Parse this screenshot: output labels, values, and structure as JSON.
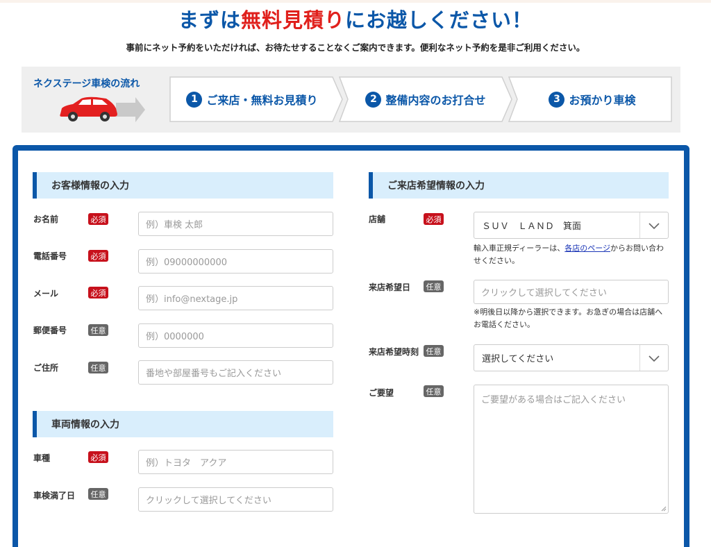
{
  "hero": {
    "title_part1": "まずは",
    "title_red": "無料見積り",
    "title_part2": "にお越しください！",
    "subtitle": "事前にネット予約をいただければ、お待たせすることなくご案内できます。便利なネット予約を是非ご利用ください。"
  },
  "flow": {
    "title": "ネクステージ車検の流れ",
    "steps": [
      {
        "num": "1",
        "label": "ご来店・無料お見積り"
      },
      {
        "num": "2",
        "label": "整備内容のお打合せ"
      },
      {
        "num": "3",
        "label": "お預かり車検"
      }
    ]
  },
  "customer": {
    "heading": "お客様情報の入力",
    "fields": [
      {
        "label": "お名前",
        "badge": "必須",
        "placeholder": "例）車検 太郎"
      },
      {
        "label": "電話番号",
        "badge": "必須",
        "placeholder": "例）09000000000"
      },
      {
        "label": "メール",
        "badge": "必須",
        "placeholder": "例）info@nextage.jp"
      },
      {
        "label": "郵便番号",
        "badge": "任意",
        "placeholder": "例）0000000"
      },
      {
        "label": "ご住所",
        "badge": "任意",
        "placeholder": "番地や部屋番号もご記入ください"
      }
    ]
  },
  "vehicle": {
    "heading": "車両情報の入力",
    "fields": [
      {
        "label": "車種",
        "badge": "必須",
        "placeholder": "例）トヨタ　アクア"
      },
      {
        "label": "車検満了日",
        "badge": "任意",
        "placeholder": "クリックして選択してください"
      }
    ]
  },
  "visit": {
    "heading": "ご来店希望情報の入力",
    "store": {
      "label": "店舗",
      "badge": "必須",
      "value": "ＳＵＶ　ＬＡＮＤ　箕面"
    },
    "store_note_pre": "輸入車正規ディーラーは、",
    "store_note_link": "各店のページ",
    "store_note_post": "からお問い合わせください。",
    "date": {
      "label": "来店希望日",
      "badge": "任意",
      "placeholder": "クリックして選択してください"
    },
    "date_note": "※明後日以降から選択できます。お急ぎの場合は店舗へお電話ください。",
    "time": {
      "label": "来店希望時刻",
      "badge": "任意",
      "value": "選択してください"
    },
    "request": {
      "label": "ご要望",
      "badge": "任意",
      "placeholder": "ご要望がある場合はご記入ください"
    }
  },
  "colors": {
    "brand_blue": "#0b57a8",
    "accent_red": "#e0201c",
    "required_badge": "#c7111c",
    "optional_badge": "#666666"
  }
}
